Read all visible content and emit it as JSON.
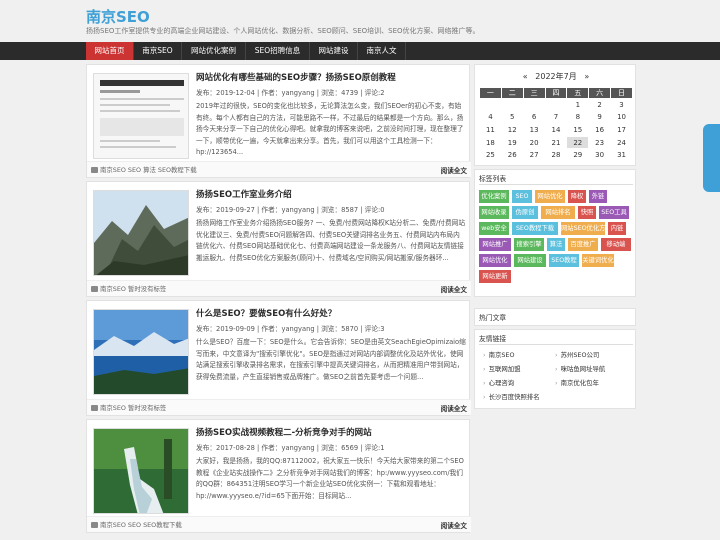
{
  "header": {
    "title": "南京SEO",
    "description": "扬扬SEO工作室提供专业的高端企业网站建设、个人网站优化、数据分析、SEO顾问、SEO培训、SEO优化方案、网络推广等。"
  },
  "nav": {
    "items": [
      "网站首页",
      "南京SEO",
      "网站优化案例",
      "SEO招聘信息",
      "网站建设",
      "南京人文"
    ]
  },
  "posts": [
    {
      "title": "网站优化有哪些基础的SEO步骤？扬扬SEO原创教程",
      "meta": "发布：2019-12-04 | 作者：yangyang | 浏览：4739 | 评论:2",
      "excerpt": "2019年过的很快，SEO的变化也比较多，无论算法怎么变，我们SEOer的初心不变，有始有终。每个人都有自己的方法，可能思路不一样，不过最后的结果都是一个方向。那么，扬扬今天来分享一下自己的优化心得吧。就拿我的博客来说吧，之前没时间打理，现在整理了一下，顺带优化一遍，今天就拿出来分享。首先，我们可以用这个工具检测一下：hp://123654...",
      "tags": "南京SEO  SEO 算法 SEO教程下载",
      "more": "阅读全文"
    },
    {
      "title": "扬扬SEO工作室业务介绍",
      "meta": "发布：2019-09-27 | 作者：yangyang | 浏览：8587 | 评论:0",
      "excerpt": "扬扬网络工作室业务介绍扬扬SEO服务? 一、免费/付费网站降权K站分析二、免费/付费网站优化建议三、免费/付费SEO问题解答四、付费SEO关键词排名业务五、付费网站内布局内链优化六、付费SEO网站基础优化七、付费高端网站建设一条龙服务八、付费网站友情链接搬运服九、付费SEO优化方案服务(顾问)十、付费域名/空间购买/网站搬家/服务器环...",
      "tags": "南京SEO  暂时没有标签",
      "more": "阅读全文"
    },
    {
      "title": "什么是SEO？要做SEO有什么好处？",
      "meta": "发布：2019-09-09 | 作者：yangyang | 浏览：5870 | 评论:3",
      "excerpt": "什么是SEO？百度一下：SEO是什么。它会告诉你：SEO是由英文SeachEgieOpimizaio缩写而来，中文意译为\"搜索引擎优化\"。SEO是指通过对网站内部调整优化及站外优化，使网站满足搜索引擎收录排名需求，在搜索引擎中提高关键词排名，从而把精准用户带到网站，获得免费流量，产生直接销售或品牌推广。做SEO之前首先要考虑一个问题...",
      "tags": "南京SEO  暂时没有标签",
      "more": "阅读全文"
    },
    {
      "title": "扬扬SEO实战视频教程二-分析竞争对手的网站",
      "meta": "发布：2017-08-28 | 作者：yangyang | 浏览：6569 | 评论:1",
      "excerpt": "大家好，我是扬扬，我的QQ:87112002，祝大家五一快乐！今天给大家带来的第二个SEO教程《企业站实战操作二》之分析竞争对手网站我们的博客：hp:/www.yyyseo.com/我们的QQ群：864351注明SEO学习一个新企业站SEO优化实例一：下载和观看地址：hp://www.yyyseo.e/?id=65下面开始：目标网站...",
      "tags": "南京SEO  SEO SEO教程下载",
      "more": "阅读全文"
    }
  ],
  "calendar": {
    "prev": "«",
    "month": "2022年7月",
    "next": "»",
    "weekdays": [
      "一",
      "二",
      "三",
      "四",
      "五",
      "六",
      "日"
    ],
    "rows": [
      [
        "",
        "",
        "",
        "",
        "1",
        "2",
        "3"
      ],
      [
        "4",
        "5",
        "6",
        "7",
        "8",
        "9",
        "10"
      ],
      [
        "11",
        "12",
        "13",
        "14",
        "15",
        "16",
        "17"
      ],
      [
        "18",
        "19",
        "20",
        "21",
        "22",
        "23",
        "24"
      ],
      [
        "25",
        "26",
        "27",
        "28",
        "29",
        "30",
        "31"
      ]
    ],
    "today": "22"
  },
  "tags_widget": {
    "title": "标签列表",
    "tags": [
      {
        "text": "优化案例",
        "color": "#5cb85c"
      },
      {
        "text": "SEO",
        "color": "#5bc0de"
      },
      {
        "text": "网站优化",
        "color": "#f0ad4e"
      },
      {
        "text": "降权",
        "color": "#d9534f"
      },
      {
        "text": "外链",
        "color": "#9b59b6"
      },
      {
        "text": "网站收录",
        "color": "#5cb85c"
      },
      {
        "text": "伪原创",
        "color": "#5bc0de"
      },
      {
        "text": "网站排名",
        "color": "#f0ad4e"
      },
      {
        "text": "快照",
        "color": "#d9534f"
      },
      {
        "text": "SEO工具",
        "color": "#9b59b6"
      },
      {
        "text": "web安全",
        "color": "#5cb85c"
      },
      {
        "text": "SEO教程下载",
        "color": "#5bc0de"
      },
      {
        "text": "网站SEO优化方案",
        "color": "#f0ad4e"
      },
      {
        "text": "内链",
        "color": "#d9534f"
      },
      {
        "text": "网站推广",
        "color": "#9b59b6"
      },
      {
        "text": "搜索引擎",
        "color": "#5cb85c"
      },
      {
        "text": "算法",
        "color": "#5bc0de"
      },
      {
        "text": "百度推广",
        "color": "#f0ad4e"
      },
      {
        "text": "移动端",
        "color": "#d9534f"
      },
      {
        "text": "网站优化",
        "color": "#9b59b6"
      },
      {
        "text": "网站建设",
        "color": "#5cb85c"
      },
      {
        "text": "SEO教程",
        "color": "#5bc0de"
      },
      {
        "text": "关键词优化",
        "color": "#f0ad4e"
      },
      {
        "text": "网站更新",
        "color": "#d9534f"
      }
    ]
  },
  "hot_widget": {
    "title": "热门文章"
  },
  "links_widget": {
    "title": "友情链接",
    "links": [
      "南京SEO",
      "苏州SEO公司",
      "互联网加盟",
      "咪咕鱼网址导航",
      "心理咨询",
      "南京优化包年",
      "长沙百度快照排名"
    ]
  },
  "colors": {
    "accent": "#3ea0d6",
    "nav_bg": "#2b2b2b",
    "nav_active": "#cc3333"
  }
}
